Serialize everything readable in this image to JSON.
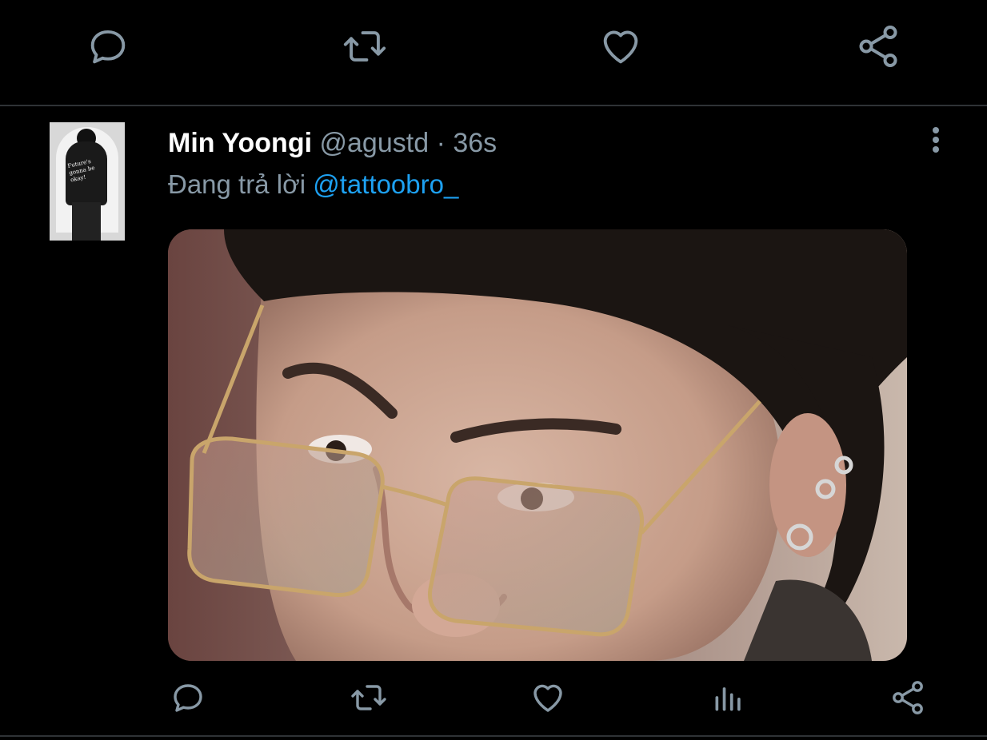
{
  "top_actions": {
    "reply_icon": "reply-bubble-icon",
    "retweet_icon": "retweet-icon",
    "like_icon": "heart-icon",
    "share_icon": "share-icon"
  },
  "tweet": {
    "author_name": "Min Yoongi",
    "author_handle": "@agustd",
    "separator": "·",
    "time_ago": "36s",
    "reply_prefix": "Đang trả lời",
    "reply_to": "@tattoobro_",
    "avatar_text": "Future's gonna be okay!",
    "more_icon": "vertical-ellipsis-icon"
  },
  "bottom_actions": {
    "reply_icon": "reply-bubble-icon",
    "retweet_icon": "retweet-icon",
    "like_icon": "heart-icon",
    "stats_icon": "analytics-icon",
    "share_icon": "share-icon"
  },
  "colors": {
    "background": "#000000",
    "primary_text": "#ffffff",
    "secondary_text": "#8899a6",
    "accent": "#1da1f2",
    "divider": "#2f3336"
  }
}
